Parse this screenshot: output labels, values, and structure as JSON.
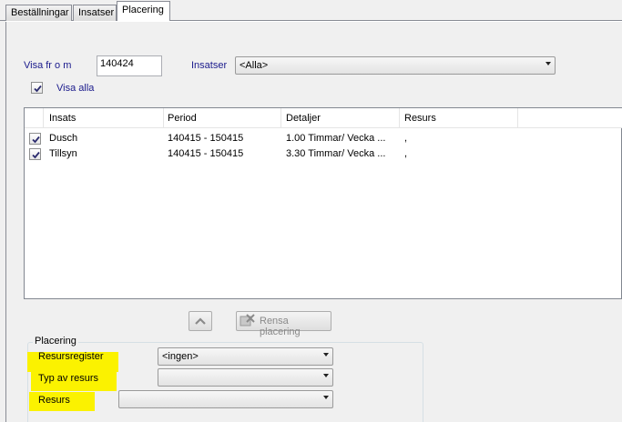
{
  "tabs": [
    {
      "label": "Beställningar",
      "active": false
    },
    {
      "label": "Insatser",
      "active": false
    },
    {
      "label": "Placering",
      "active": true
    }
  ],
  "filter": {
    "visa_from_label": "Visa fr o m",
    "visa_from_value": "140424",
    "insatser_label": "Insatser",
    "insatser_value": "<Alla>",
    "visa_alla_label": "Visa alla",
    "visa_alla_checked": true
  },
  "list": {
    "columns": [
      "Insats",
      "Period",
      "Detaljer",
      "Resurs"
    ],
    "rows": [
      {
        "checked": true,
        "insats": "Dusch",
        "period": "140415 - 150415",
        "detaljer": "1.00 Timmar/ Vecka  ...",
        "resurs": ","
      },
      {
        "checked": true,
        "insats": "Tillsyn",
        "period": "140415 - 150415",
        "detaljer": "3.30 Timmar/ Vecka  ...",
        "resurs": ","
      }
    ]
  },
  "buttons": {
    "up_icon": "chevron-up-icon",
    "rensa_label": "Rensa placering",
    "rensa_icon": "clear-placement-icon"
  },
  "placering": {
    "title": "Placering",
    "resursregister_label": "Resursregister",
    "resursregister_value": "<ingen>",
    "typ_label": "Typ av resurs",
    "typ_value": "",
    "resurs_label": "Resurs",
    "resurs_value": ""
  },
  "colors": {
    "highlight": "#fbf200",
    "label_blue": "#1a1a8c"
  }
}
